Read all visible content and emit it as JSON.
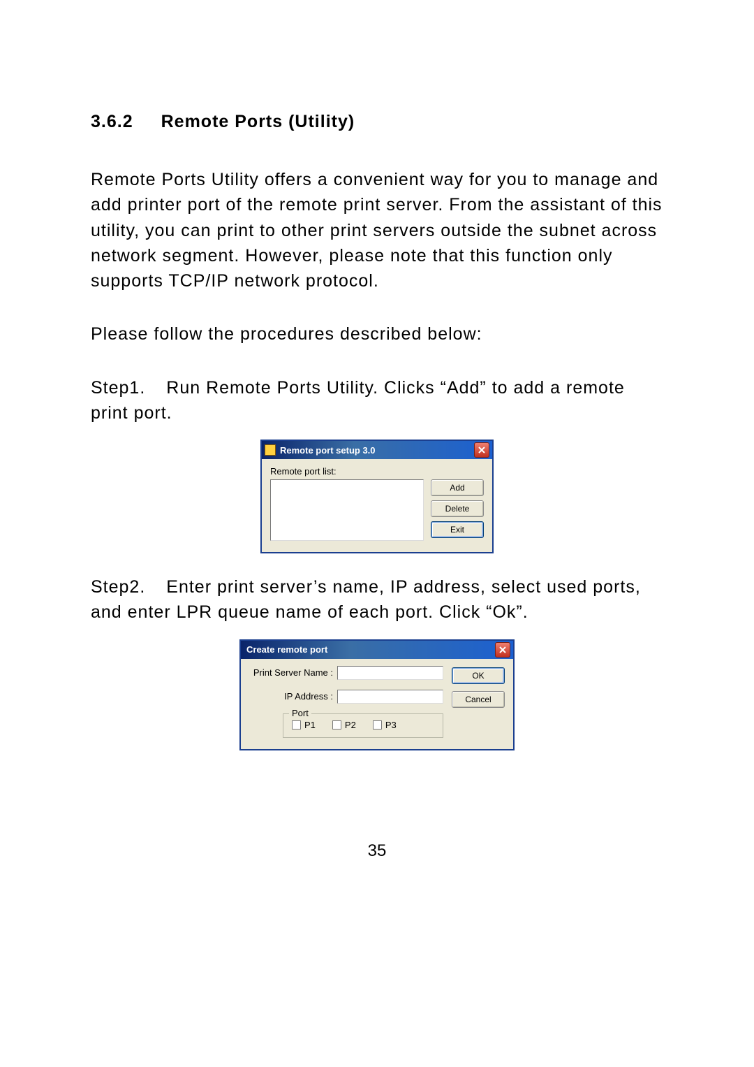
{
  "heading": {
    "number": "3.6.2",
    "title": "Remote Ports (Utility)"
  },
  "paragraphs": {
    "intro": "Remote Ports Utility offers a convenient way for you to manage and add printer port of the remote print server. From the assistant of this utility, you can print to other print servers outside the subnet across network segment. However, please note that this function only supports TCP/IP network protocol.",
    "follow": "Please follow the procedures described below:",
    "step1_label": "Step1.",
    "step1_text": "Run Remote Ports Utility. Clicks “Add” to add a remote print port.",
    "step2_label": "Step2.",
    "step2_text": "Enter print server’s name, IP address, select used ports, and enter LPR queue name of each port. Click “Ok”."
  },
  "dialog1": {
    "title": "Remote port setup 3.0",
    "list_label": "Remote port list:",
    "buttons": {
      "add": "Add",
      "delete": "Delete",
      "exit": "Exit"
    }
  },
  "dialog2": {
    "title": "Create remote port",
    "labels": {
      "print_server_name": "Print Server Name :",
      "ip_address": "IP Address :",
      "port_group": "Port",
      "p1": "P1",
      "p2": "P2",
      "p3": "P3"
    },
    "buttons": {
      "ok": "OK",
      "cancel": "Cancel"
    }
  },
  "page_number": "35"
}
